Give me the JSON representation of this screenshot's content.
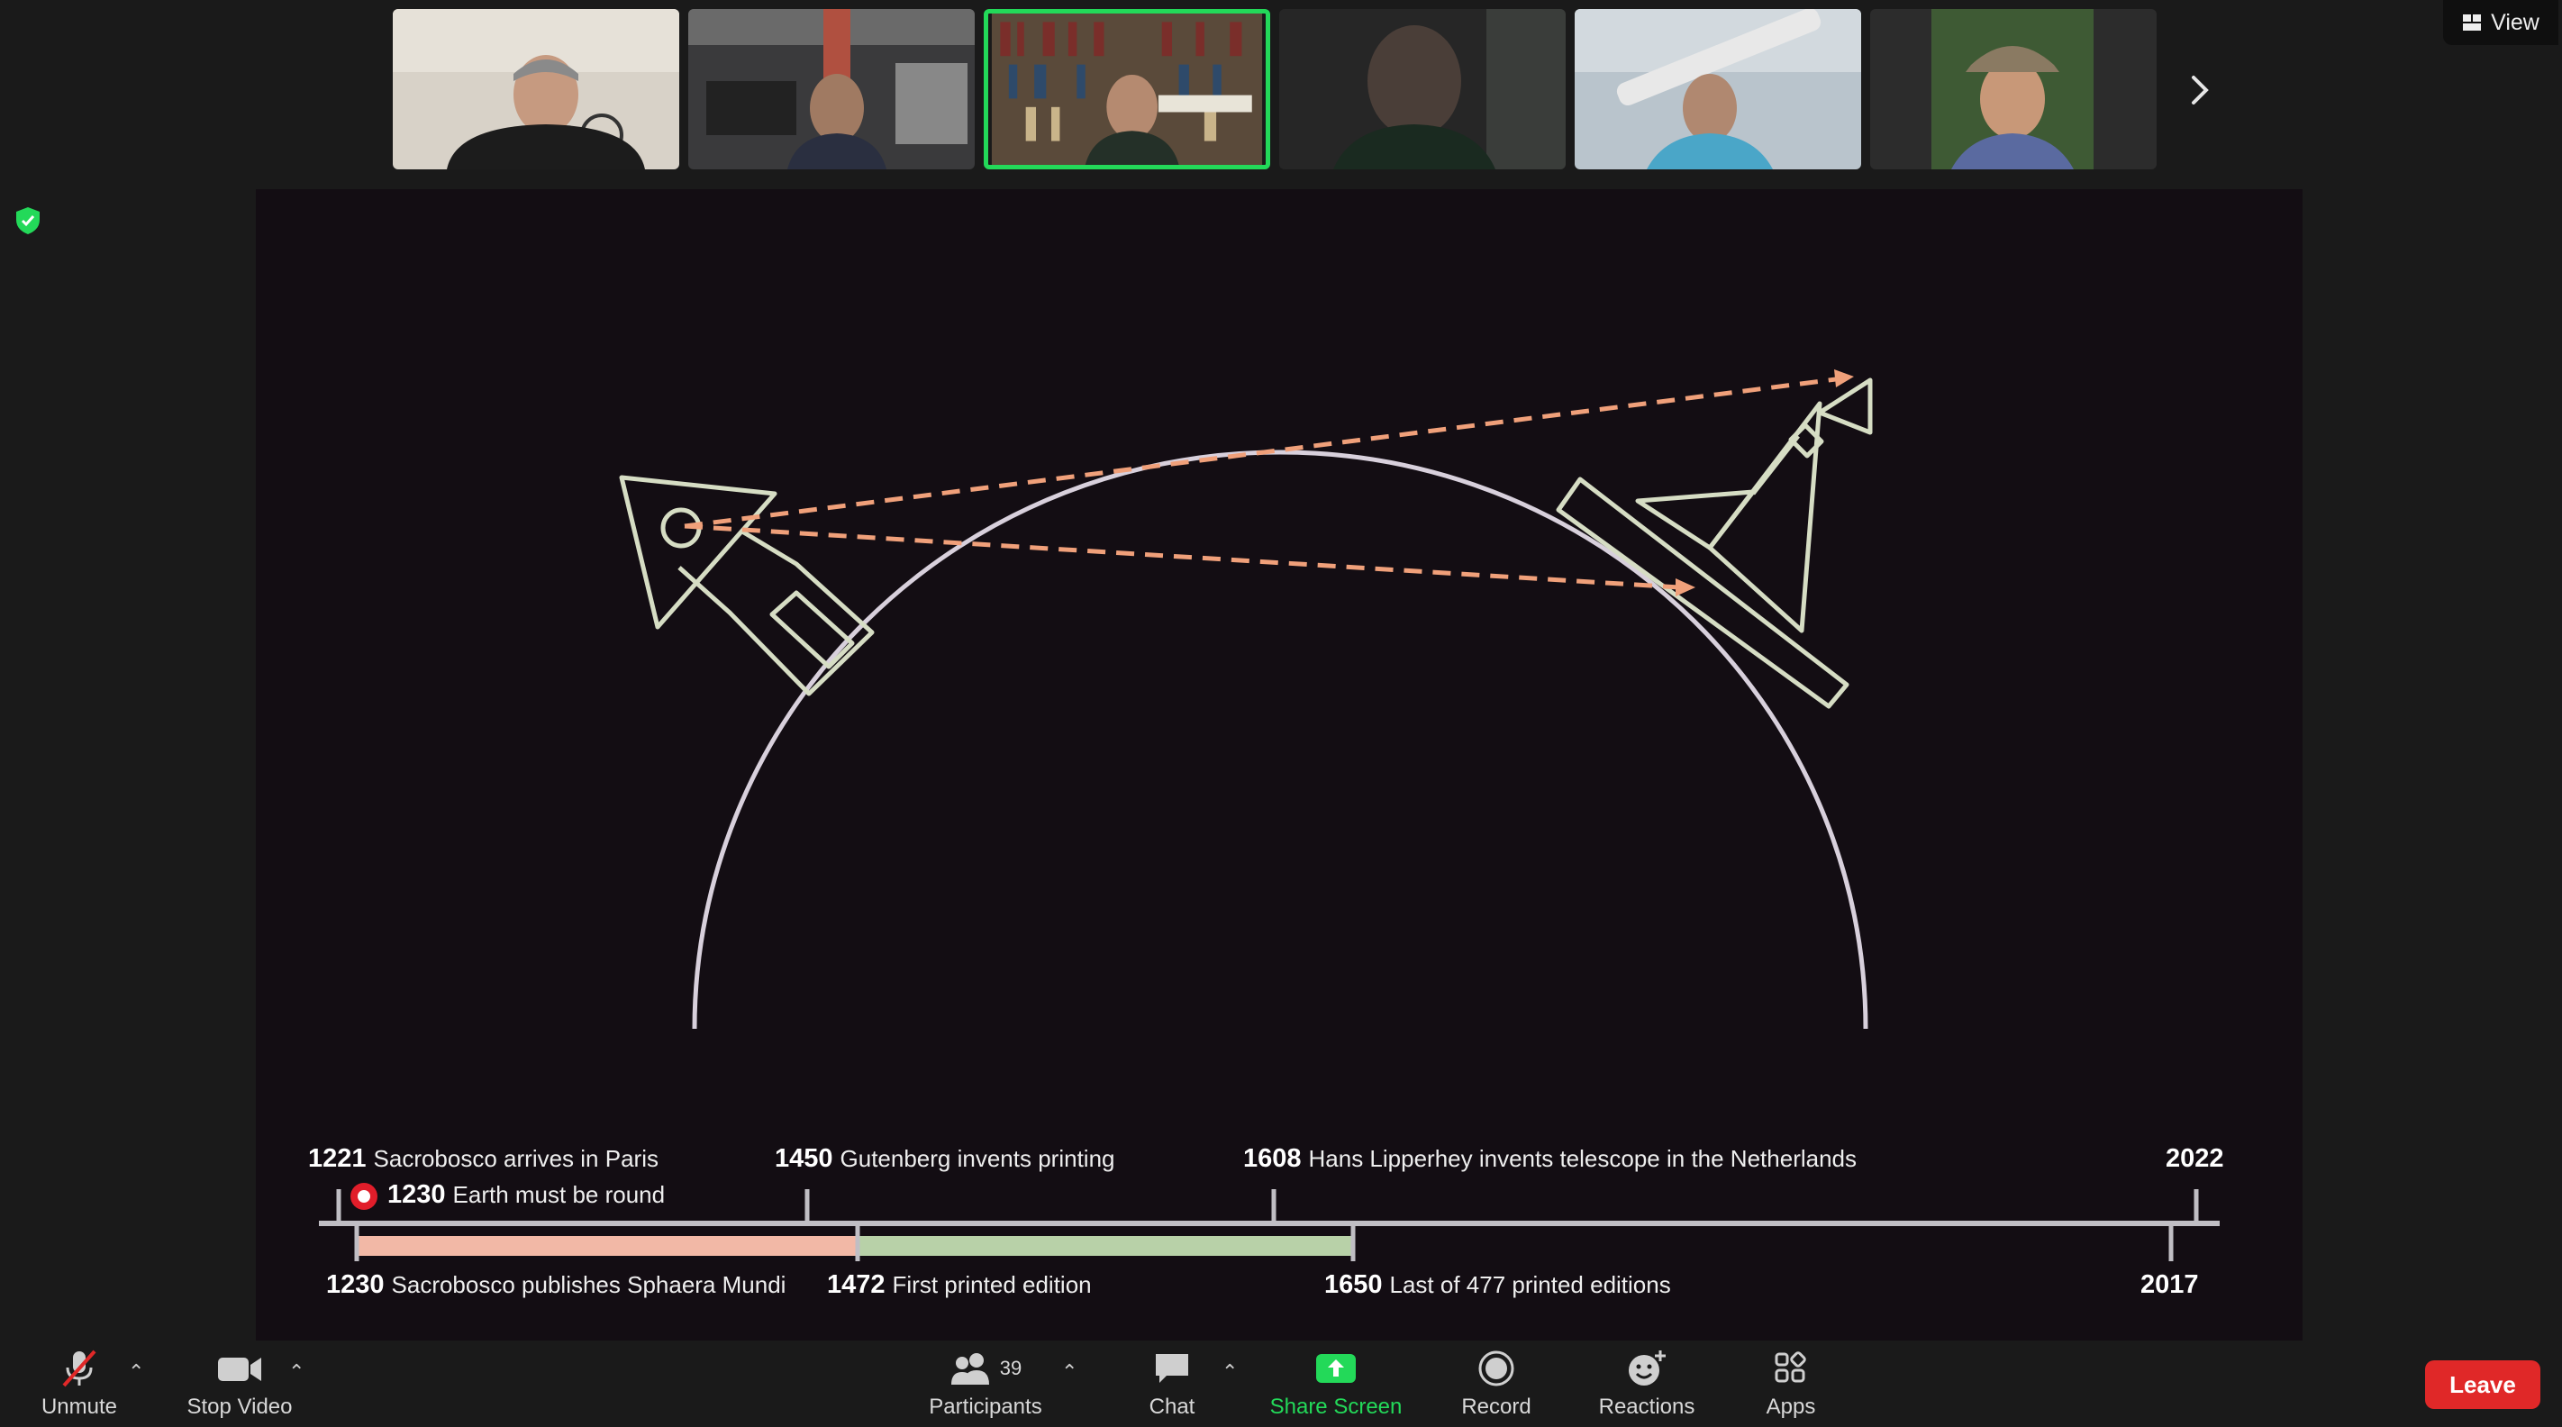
{
  "top_bar": {
    "view_label": "View"
  },
  "timeline": {
    "above": [
      {
        "year": "1221",
        "text": "Sacrobosco arrives in Paris"
      },
      {
        "year": "1230",
        "text": "Earth must be round"
      },
      {
        "year": "1450",
        "text": "Gutenberg invents printing"
      },
      {
        "year": "1608",
        "text": "Hans Lipperhey invents telescope in the Netherlands"
      },
      {
        "year": "2022",
        "text": ""
      }
    ],
    "below": [
      {
        "year": "1230",
        "text": "Sacrobosco publishes Sphaera Mundi"
      },
      {
        "year": "1472",
        "text": "First printed edition"
      },
      {
        "year": "1650",
        "text": "Last of 477 printed editions"
      },
      {
        "year": "2017",
        "text": ""
      }
    ]
  },
  "toolbar": {
    "unmute": "Unmute",
    "stop_video": "Stop Video",
    "participants": "Participants",
    "participants_count": "39",
    "chat": "Chat",
    "share_screen": "Share Screen",
    "record": "Record",
    "reactions": "Reactions",
    "apps": "Apps",
    "leave": "Leave"
  },
  "colors": {
    "background": "#1a1a1a",
    "slide_bg": "#130d13",
    "accent_green": "#23d959",
    "leave_red": "#e02828",
    "arrow_orange": "#f0a07a",
    "bar_pink": "#f2b8a6",
    "bar_green": "#b8d1a8",
    "drawing_green": "#d6ddc4",
    "earth_arc": "#d8d0dc",
    "marker_red": "#e11d2a"
  }
}
